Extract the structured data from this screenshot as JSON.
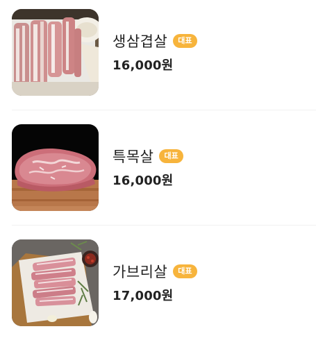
{
  "menu": {
    "items": [
      {
        "name": "생삼겹살",
        "badge": "대표",
        "price": "16,000원",
        "image_icon": "pork-belly-image"
      },
      {
        "name": "특목살",
        "badge": "대표",
        "price": "16,000원",
        "image_icon": "pork-neck-image"
      },
      {
        "name": "가브리살",
        "badge": "대표",
        "price": "17,000원",
        "image_icon": "pork-jowl-image"
      }
    ]
  },
  "colors": {
    "badge_bg": "#f7b43c",
    "text": "#222222",
    "divider": "#f1f1f1"
  }
}
